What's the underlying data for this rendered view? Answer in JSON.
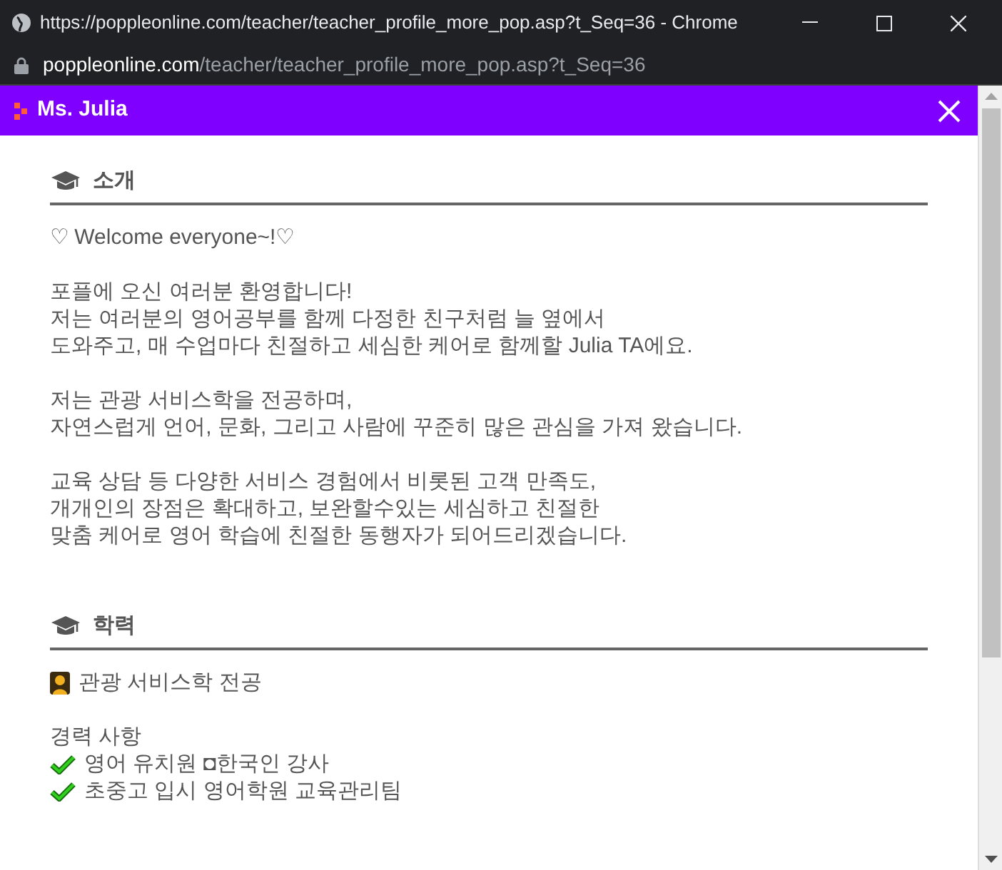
{
  "window": {
    "title": "https://poppleonline.com/teacher/teacher_profile_more_pop.asp?t_Seq=36 - Chrome"
  },
  "address_bar": {
    "domain": "poppleonline.com",
    "path": "/teacher/teacher_profile_more_pop.asp?t_Seq=36"
  },
  "popup": {
    "title": "Ms. Julia"
  },
  "sections": [
    {
      "heading": "소개",
      "paragraphs": [
        [
          "♡ Welcome everyone~!♡"
        ],
        [
          "포플에 오신 여러분 환영합니다!",
          "저는 여러분의 영어공부를 함께 다정한 친구처럼 늘 옆에서",
          "도와주고, 매 수업마다 친절하고 세심한 케어로 함께할 Julia TA에요."
        ],
        [
          "저는 관광 서비스학을 전공하며,",
          "자연스럽게 언어, 문화, 그리고 사람에 꾸준히 많은 관심을 가져 왔습니다."
        ],
        [
          "교육 상담 등 다양한 서비스 경험에서 비롯된 고객 만족도,",
          "개개인의 장점은 확대하고, 보완할수있는 세심하고 친절한",
          "맞춤 케어로 영어 학습에 친절한 동행자가 되어드리겠습니다."
        ]
      ]
    },
    {
      "heading": "학력",
      "major": "관광 서비스학 전공",
      "career_heading": "경력 사항",
      "career": [
        "영어 유치원 ◘한국인 강사",
        "초중고 입시 영어학원 교육관리팀"
      ]
    }
  ]
}
